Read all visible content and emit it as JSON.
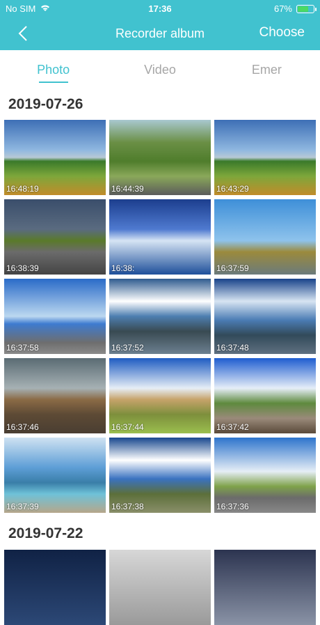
{
  "status_bar": {
    "carrier": "No SIM",
    "time": "17:36",
    "battery": "67%",
    "battery_level": 0.67
  },
  "nav": {
    "title": "Recorder album",
    "choose_label": "Choose"
  },
  "tabs": [
    {
      "label": "Photo",
      "active": true
    },
    {
      "label": "Video",
      "active": false
    },
    {
      "label": "Emer",
      "active": false
    }
  ],
  "groups": [
    {
      "date": "2019-07-26",
      "photos": [
        {
          "time": "16:48:19"
        },
        {
          "time": "16:44:39"
        },
        {
          "time": "16:43:29"
        },
        {
          "time": "16:38:39"
        },
        {
          "time": "16:38:"
        },
        {
          "time": "16:37:59"
        },
        {
          "time": "16:37:58"
        },
        {
          "time": "16:37:52"
        },
        {
          "time": "16:37:48"
        },
        {
          "time": "16:37:46"
        },
        {
          "time": "16:37:44"
        },
        {
          "time": "16:37:42"
        },
        {
          "time": "16:37:39"
        },
        {
          "time": "16:37:38"
        },
        {
          "time": "16:37:36"
        }
      ]
    },
    {
      "date": "2019-07-22",
      "photos": [
        {
          "time": ""
        },
        {
          "time": ""
        },
        {
          "time": ""
        }
      ]
    }
  ],
  "colors": {
    "accent": "#41c2cf",
    "inactive_tab": "#a6a6a6"
  }
}
